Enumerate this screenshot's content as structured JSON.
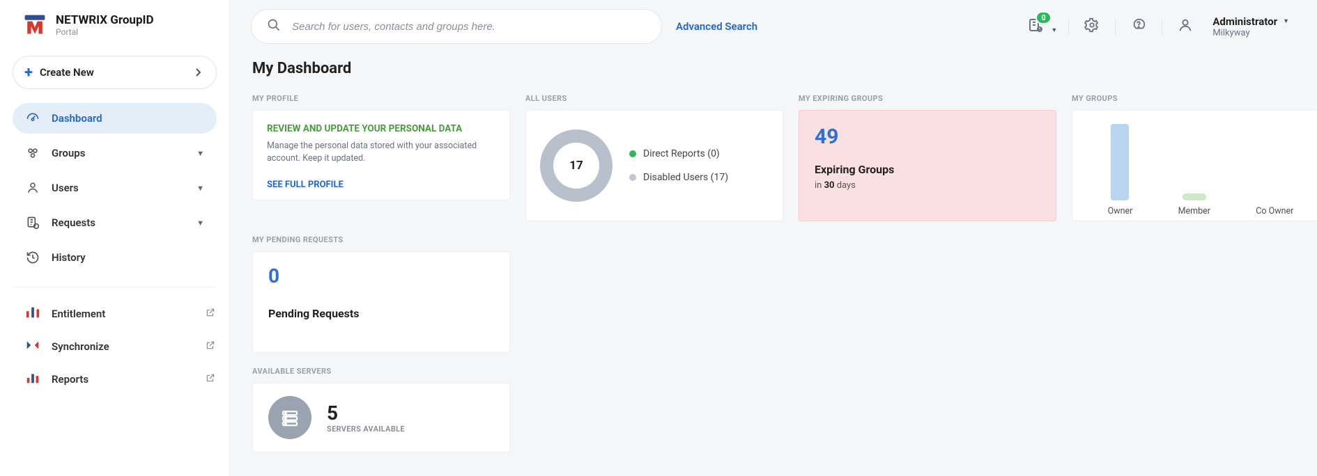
{
  "brand": {
    "title": "NETWRIX GroupID",
    "subtitle": "Portal"
  },
  "create_btn": "Create New",
  "nav": {
    "dashboard": "Dashboard",
    "groups": "Groups",
    "users": "Users",
    "requests": "Requests",
    "history": "History"
  },
  "ext": {
    "entitlement": "Entitlement",
    "synchronize": "Synchronize",
    "reports": "Reports"
  },
  "search": {
    "placeholder": "Search for users, contacts and groups here.",
    "advanced": "Advanced Search"
  },
  "topbar": {
    "cart_badge": "0",
    "user_name": "Administrator",
    "user_org": "Milkyway"
  },
  "page_title": "My Dashboard",
  "sections": {
    "profile": "MY PROFILE",
    "all_users": "ALL USERS",
    "expiring": "MY EXPIRING GROUPS",
    "mygroups": "MY GROUPS",
    "pending": "MY PENDING REQUESTS",
    "servers": "AVAILABLE SERVERS"
  },
  "profile_card": {
    "title": "REVIEW AND UPDATE YOUR PERSONAL DATA",
    "text": "Manage the personal data stored with your associated account. Keep it updated.",
    "link": "SEE FULL PROFILE"
  },
  "users_card": {
    "total": "17",
    "legend1": "Direct Reports (0)",
    "legend2": "Disabled Users (17)"
  },
  "expiring_card": {
    "count": "49",
    "title": "Expiring Groups",
    "sub_prefix": "in ",
    "sub_days": "30",
    "sub_suffix": " days"
  },
  "groups_bars": {
    "owner": "Owner",
    "member": "Member",
    "coowner": "Co Owner"
  },
  "pending_card": {
    "count": "0",
    "title": "Pending Requests"
  },
  "servers_card": {
    "count": "5",
    "label": "SERVERS AVAILABLE"
  },
  "chart_data": [
    {
      "type": "pie",
      "title": "All Users",
      "total": 17,
      "series": [
        {
          "name": "Direct Reports",
          "value": 0,
          "color": "#2eb85c"
        },
        {
          "name": "Disabled Users",
          "value": 17,
          "color": "#c1c7d0"
        }
      ]
    },
    {
      "type": "bar",
      "title": "My Groups",
      "categories": [
        "Owner",
        "Member",
        "Co Owner"
      ],
      "values": [
        49,
        3,
        0
      ]
    }
  ]
}
